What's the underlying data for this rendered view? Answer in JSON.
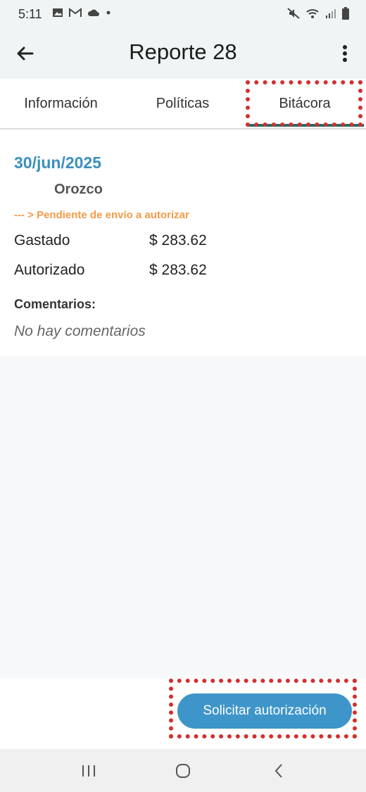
{
  "status_bar": {
    "time": "5:11",
    "left_icons": [
      "image-icon",
      "gmail-icon",
      "cloud-icon",
      "dot-icon"
    ],
    "right_icons": [
      "mute-icon",
      "wifi-icon",
      "signal-icon",
      "battery-icon"
    ]
  },
  "app_bar": {
    "title": "Reporte 28",
    "back_icon": "arrow-left-icon",
    "menu_icon": "more-vert-icon"
  },
  "tabs": {
    "items": [
      {
        "label": "Información"
      },
      {
        "label": "Políticas"
      },
      {
        "label": "Bitácora"
      }
    ],
    "selected": "Bitácora"
  },
  "log": {
    "date": "30/jun/2025",
    "user": "Orozco",
    "status": "--- > Pendiente de envío a autorizar",
    "spent_label": "Gastado",
    "spent_value": "$ 283.62",
    "authorized_label": "Autorizado",
    "authorized_value": "$ 283.62",
    "comments_label": "Comentarios:",
    "comments_empty": "No hay comentarios"
  },
  "actions": {
    "request_label": "Solicitar autorización"
  },
  "colors": {
    "accent": "#3b8fc1",
    "status_orange": "#f39a46",
    "tab_indicator": "#1f6f6a",
    "highlight": "#d32f2f"
  }
}
